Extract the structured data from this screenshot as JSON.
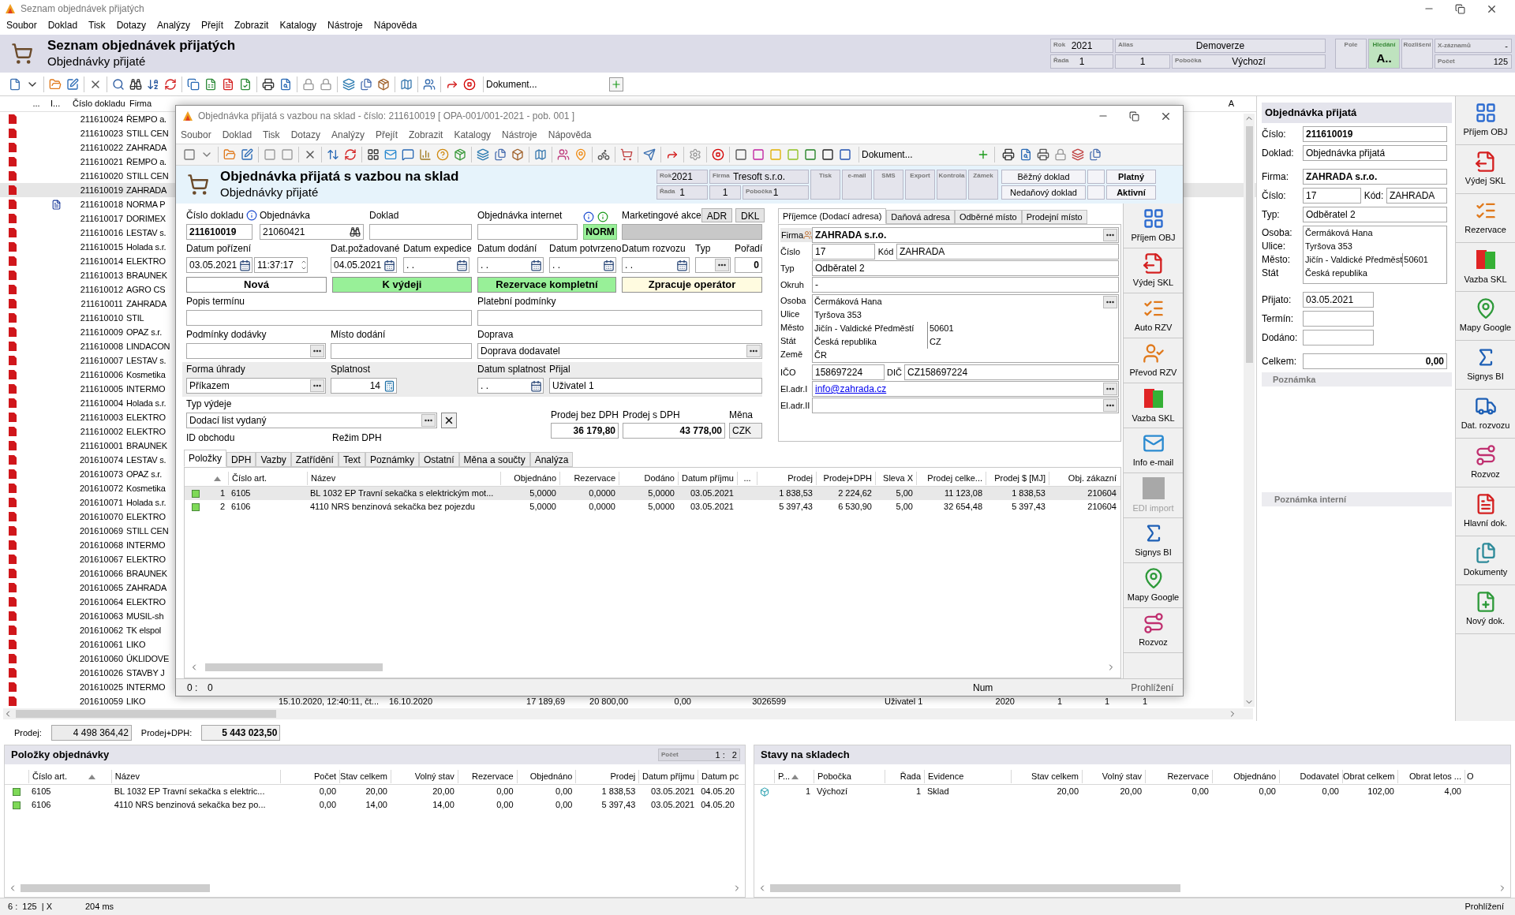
{
  "window": {
    "title": "Seznam objednávek přijatých"
  },
  "menu": [
    "Soubor",
    "Doklad",
    "Tisk",
    "Dotazy",
    "Analýzy",
    "Přejít",
    "Zobrazit",
    "Katalogy",
    "Nástroje",
    "Nápověda"
  ],
  "header": {
    "title": "Seznam objednávek přijatých",
    "subtitle": "Objednávky přijaté",
    "info": [
      {
        "label": "Rok",
        "value": "2021"
      },
      {
        "label": "Alias",
        "value": "Demoverze"
      },
      {
        "label": "Řada",
        "value": "1"
      },
      {
        "value": "1"
      },
      {
        "label": "Pobočka",
        "value": "Výchozí"
      }
    ],
    "search_info": [
      {
        "label": "Pole",
        "selected": false
      },
      {
        "label": "Hledání",
        "value": "A..",
        "selected": true
      },
      {
        "label": "Rozlišení",
        "selected": false
      },
      {
        "label": "X-záznamů",
        "value": "-",
        "selected": false
      },
      {
        "label": "Počet",
        "value": "125",
        "selected": false
      }
    ]
  },
  "toolbar": {
    "document_placeholder": "Dokument..."
  },
  "list": {
    "columns": [
      "...",
      "I...",
      "Číslo dokladu",
      "Firma"
    ],
    "column_right": "A",
    "rows": [
      {
        "number": "211610024",
        "firm": "ŘEMPO a.",
        "selected": false,
        "linked": false
      },
      {
        "number": "211610023",
        "firm": "STILL CEN",
        "selected": false,
        "linked": false
      },
      {
        "number": "211610022",
        "firm": "ZAHRADA",
        "selected": false,
        "linked": false
      },
      {
        "number": "211610021",
        "firm": "ŘEMPO a.",
        "selected": false,
        "linked": false
      },
      {
        "number": "211610020",
        "firm": "STILL CEN",
        "selected": false,
        "linked": false
      },
      {
        "number": "211610019",
        "firm": "ZAHRADA",
        "selected": true,
        "linked": false
      },
      {
        "number": "211610018",
        "firm": "NORMA P",
        "selected": false,
        "linked": true
      },
      {
        "number": "211610017",
        "firm": "DORIMEX",
        "selected": false,
        "linked": false
      },
      {
        "number": "211610016",
        "firm": "LESTAV s.",
        "selected": false,
        "linked": false
      },
      {
        "number": "211610015",
        "firm": "Holada s.r.",
        "selected": false,
        "linked": false
      },
      {
        "number": "211610014",
        "firm": "ELEKTRO",
        "selected": false,
        "linked": false
      },
      {
        "number": "211610013",
        "firm": "BRAUNEK",
        "selected": false,
        "linked": false
      },
      {
        "number": "211610012",
        "firm": "AGRO CS",
        "selected": false,
        "linked": false
      },
      {
        "number": "211610011",
        "firm": "ZAHRADA",
        "selected": false,
        "linked": false
      },
      {
        "number": "211610010",
        "firm": "STIL",
        "selected": false,
        "linked": false
      },
      {
        "number": "211610009",
        "firm": "OPAZ s.r.",
        "selected": false,
        "linked": false
      },
      {
        "number": "211610008",
        "firm": "LINDACON",
        "selected": false,
        "linked": false
      },
      {
        "number": "211610007",
        "firm": "LESTAV s.",
        "selected": false,
        "linked": false
      },
      {
        "number": "211610006",
        "firm": "Kosmetika",
        "selected": false,
        "linked": false
      },
      {
        "number": "211610005",
        "firm": "INTERMO",
        "selected": false,
        "linked": false
      },
      {
        "number": "211610004",
        "firm": "Holada s.r.",
        "selected": false,
        "linked": false
      },
      {
        "number": "211610003",
        "firm": "ELEKTRO",
        "selected": false,
        "linked": false
      },
      {
        "number": "211610002",
        "firm": "ELEKTRO",
        "selected": false,
        "linked": false
      },
      {
        "number": "211610001",
        "firm": "BRAUNEK",
        "selected": false,
        "linked": false
      },
      {
        "number": "201610074",
        "firm": "LESTAV s.",
        "selected": false,
        "linked": false
      },
      {
        "number": "201610073",
        "firm": "OPAZ s.r.",
        "selected": false,
        "linked": false
      },
      {
        "number": "201610072",
        "firm": "Kosmetika",
        "selected": false,
        "linked": false
      },
      {
        "number": "201610071",
        "firm": "Holada s.r.",
        "selected": false,
        "linked": false
      },
      {
        "number": "201610070",
        "firm": "ELEKTRO",
        "selected": false,
        "linked": false
      },
      {
        "number": "201610069",
        "firm": "STILL CEN",
        "selected": false,
        "linked": false
      },
      {
        "number": "201610068",
        "firm": "INTERMO",
        "selected": false,
        "linked": false
      },
      {
        "number": "201610067",
        "firm": "ELEKTRO",
        "selected": false,
        "linked": false
      },
      {
        "number": "201610066",
        "firm": "BRAUNEK",
        "selected": false,
        "linked": false
      },
      {
        "number": "201610065",
        "firm": "ZAHRADA",
        "selected": false,
        "linked": false
      },
      {
        "number": "201610064",
        "firm": "ELEKTRO",
        "selected": false,
        "linked": false
      },
      {
        "number": "201610063",
        "firm": "MUSIL-sh",
        "selected": false,
        "linked": false
      },
      {
        "number": "201610062",
        "firm": "TK elspol",
        "selected": false,
        "linked": false
      },
      {
        "number": "201610061",
        "firm": "LIKO",
        "selected": false,
        "linked": false
      },
      {
        "number": "201610060",
        "firm": "ÚKLIDOVE",
        "selected": false,
        "linked": false
      },
      {
        "number": "201610026",
        "firm": "STAVBY J",
        "selected": false,
        "linked": false
      },
      {
        "number": "201610025",
        "firm": "INTERMO",
        "selected": false,
        "linked": false
      },
      {
        "number": "201610059",
        "firm": "LIKO",
        "selected": false,
        "linked": false,
        "extra": [
          "15.10.2020, 12:40:11, čt...",
          "16.10.2020",
          "17 189,69",
          "20 800,00",
          "0,00",
          "3026599",
          "Uživatel 1",
          "2020",
          "1",
          "1",
          "1"
        ]
      }
    ]
  },
  "side_panel": {
    "title": "Objednávka přijatá",
    "cislo": {
      "label": "Číslo:",
      "value": "211610019"
    },
    "doklad": {
      "label": "Doklad:",
      "value": "Objednávka přijatá"
    },
    "firma": {
      "label": "Firma:",
      "value": "ZAHRADA s.r.o."
    },
    "cislo2": {
      "label": "Číslo:",
      "value": "17"
    },
    "kod": {
      "label": "Kód:",
      "value": "ZAHRADA"
    },
    "typ": {
      "label": "Typ:",
      "value": "Odběratel 2"
    },
    "address": [
      {
        "label": "Osoba:",
        "value": "Čermáková Hana"
      },
      {
        "label": "Ulice:",
        "value": "Tyršova 353"
      },
      {
        "label": "Město:",
        "value": "Jičín - Valdické Předměst",
        "value2": "50601"
      },
      {
        "label": "Stát",
        "value": "Česká republika"
      }
    ],
    "prijato": {
      "label": "Přijato:",
      "value": "03.05.2021"
    },
    "termin": {
      "label": "Termín:"
    },
    "dodano": {
      "label": "Dodáno:"
    },
    "celkem": {
      "label": "Celkem:",
      "value": "0,00"
    },
    "sections": [
      "Poznámka",
      "Poznámka interní"
    ]
  },
  "side_buttons": [
    {
      "label": "Příjem OBJ"
    },
    {
      "label": "Výdej SKL"
    },
    {
      "label": "Rezervace"
    },
    {
      "label": "Vazba SKL"
    },
    {
      "label": "Mapy Google"
    },
    {
      "label": "Signys BI"
    },
    {
      "label": "Dat. rozvozu"
    },
    {
      "label": "Rozvoz"
    },
    {
      "label": "Hlavní dok."
    },
    {
      "label": "Dokumenty"
    },
    {
      "label": "Nový dok."
    }
  ],
  "sums": {
    "prodej": {
      "label": "Prodej:",
      "value": "4 498 364,42"
    },
    "prodej_dph": {
      "label": "Prodej+DPH:",
      "value": "5 443 023,50"
    }
  },
  "items_panel": {
    "title": "Položky objednávky",
    "count_label": "Počet",
    "count": "1 :   2",
    "columns": [
      "Číslo art.",
      "Název",
      "Počet",
      "Stav celkem",
      "Volný stav",
      "Rezervace",
      "Objednáno",
      "Prodej",
      "Datum příjmu",
      "Datum pc"
    ],
    "rows": [
      {
        "color": "#7ed957",
        "cells": [
          "6105",
          "BL 1032 EP Travní sekačka s elektric...",
          "0,00",
          "20,00",
          "20,00",
          "0,00",
          "0,00",
          "1 838,53",
          "03.05.2021",
          "04.05.20"
        ]
      },
      {
        "color": "#7ed957",
        "cells": [
          "6106",
          "4110 NRS benzinová sekačka bez po...",
          "0,00",
          "14,00",
          "14,00",
          "0,00",
          "0,00",
          "5 397,43",
          "03.05.2021",
          "04.05.20"
        ]
      }
    ]
  },
  "stock_panel": {
    "title": "Stavy na skladech",
    "columns": [
      "P...",
      "Pobočka",
      "Řada",
      "Evidence",
      "Stav celkem",
      "Volný stav",
      "Rezervace",
      "Objednáno",
      "Dodavatel",
      "Obrat celkem",
      "Obrat letos ...",
      "O"
    ],
    "rows": [
      {
        "cells": [
          "1",
          "Výchozí",
          "1",
          "Sklad",
          "20,00",
          "20,00",
          "0,00",
          "0,00",
          "0,00",
          "102,00",
          "4,00"
        ]
      }
    ]
  },
  "status_bar": {
    "position": "6 :  125  | X",
    "time": "204 ms",
    "mode": "Prohlížení"
  },
  "dialog": {
    "title": "Objednávka přijatá s vazbou na sklad - číslo: 211610019  [ OPA-001/001-2021 - pob. 001 ]",
    "menu": [
      "Soubor",
      "Doklad",
      "Tisk",
      "Dotazy",
      "Analýzy",
      "Přejít",
      "Zobrazit",
      "Katalogy",
      "Nástroje",
      "Nápověda"
    ],
    "document_placeholder": "Dokument...",
    "header": {
      "title": "Objednávka přijatá s vazbou na sklad",
      "subtitle": "Objednávky přijaté",
      "info": [
        {
          "label": "Rok",
          "value": "2021"
        },
        {
          "label": "Firma",
          "value": "Tresoft s.r.o."
        },
        {
          "label": "Řada",
          "value": "1"
        },
        {
          "value": "1"
        },
        {
          "label": "Pobočka",
          "value": "1"
        }
      ],
      "flags": [
        "Tisk",
        "e-mail",
        "SMS",
        "Export",
        "Kontrola",
        "Zámek"
      ],
      "doc_types": [
        "Běžný doklad",
        "Nedaňový doklad"
      ],
      "states": [
        "Platný",
        "Aktivní"
      ]
    },
    "form": {
      "cislo_dokladu": {
        "label": "Číslo dokladu",
        "value": "211610019"
      },
      "objednavka": {
        "label": "Objednávka",
        "value": "21060421"
      },
      "doklad": {
        "label": "Doklad"
      },
      "objednavka_internet": {
        "label": "Objednávka internet",
        "badge": "NORM"
      },
      "marketingove_akce": {
        "label": "Marketingové akce",
        "buttons": [
          "ADR",
          "DKL"
        ]
      },
      "datum_porizeni": {
        "label": "Datum pořízení",
        "value": "03.05.2021",
        "time": "11:37:17"
      },
      "dat_pozadovane": {
        "label": "Dat.požadované",
        "value": "04.05.2021"
      },
      "datum_expedice": {
        "label": "Datum expedice",
        "value": ". ."
      },
      "datum_dodani": {
        "label": "Datum dodání",
        "value": ". ."
      },
      "datum_potvrzeno": {
        "label": "Datum potvrzeno",
        "value": ". ."
      },
      "datum_rozvozu": {
        "label": "Datum rozvozu",
        "value": ". ."
      },
      "typ": {
        "label": "Typ"
      },
      "poradi": {
        "label": "Pořadí",
        "value": "0"
      },
      "statuses": [
        {
          "text": "Nová",
          "color": "#ffffff"
        },
        {
          "text": "K výdeji",
          "color": "#98f098"
        },
        {
          "text": "Rezervace kompletní",
          "color": "#98f098"
        },
        {
          "text": "Zpracuje operátor",
          "color": "#fffbe0"
        }
      ],
      "popis_terminu": {
        "label": "Popis termínu"
      },
      "platebni_podminky": {
        "label": "Platební podmínky"
      },
      "podminky_dodavky": {
        "label": "Podmínky dodávky"
      },
      "misto_dodani": {
        "label": "Místo dodání"
      },
      "doprava": {
        "label": "Doprava",
        "value": "Doprava dodavatel"
      },
      "forma_uhrady": {
        "label": "Forma úhrady",
        "value": "Příkazem"
      },
      "splatnost": {
        "label": "Splatnost",
        "value": "14"
      },
      "datum_splatnost": {
        "label": "Datum splatnost",
        "value": ". ."
      },
      "prijal": {
        "label": "Přijal",
        "value": "Uživatel 1"
      },
      "typ_vydeje": {
        "label": "Typ výdeje",
        "value": "Dodací list vydaný"
      },
      "prodej_bez_dph": {
        "label": "Prodej bez DPH",
        "value": "36 179,80"
      },
      "prodej_s_dph": {
        "label": "Prodej s DPH",
        "value": "43 778,00"
      },
      "mena": {
        "label": "Měna",
        "value": "CZK"
      },
      "id_obchodu": {
        "label": "ID obchodu"
      },
      "rezim_dph": {
        "label": "Režim DPH"
      }
    },
    "address": {
      "tabs": [
        {
          "label": "Příjemce (Dodací adresa)",
          "selected": true
        },
        {
          "label": "Daňová adresa",
          "selected": false
        },
        {
          "label": "Odběrné místo",
          "selected": false
        },
        {
          "label": "Prodejní místo",
          "selected": false
        }
      ],
      "firma": {
        "label": "Firma",
        "value": "ZAHRADA s.r.o."
      },
      "cislo": {
        "label": "Číslo",
        "value": "17"
      },
      "kod": {
        "label": "Kód",
        "value": "ZAHRADA"
      },
      "typ": {
        "label": "Typ",
        "value": "Odběratel 2"
      },
      "okruh": {
        "label": "Okruh",
        "value": "-"
      },
      "lines": [
        {
          "label": "Osoba",
          "value": "Čermáková Hana"
        },
        {
          "label": "Ulice",
          "value": "Tyršova 353"
        },
        {
          "label": "Město",
          "value": "Jičín - Valdické Předměstí",
          "value2": "50601"
        },
        {
          "label": "Stát",
          "value": "Česká republika",
          "value2": "CZ"
        },
        {
          "label": "Země",
          "value": "ČR"
        }
      ],
      "ico": {
        "label": "IČO",
        "value": "158697224"
      },
      "dic": {
        "label": "DIČ",
        "value": "CZ158697224"
      },
      "email1": {
        "label": "El.adr.I",
        "value": "info@zahrada.cz"
      },
      "email2": {
        "label": "El.adr.II"
      }
    },
    "tabs": [
      {
        "label": "Položky",
        "selected": true
      },
      {
        "label": "DPH",
        "selected": false
      },
      {
        "label": "Vazby",
        "selected": false
      },
      {
        "label": "Zatřídění",
        "selected": false
      },
      {
        "label": "Text",
        "selected": false
      },
      {
        "label": "Poznámky",
        "selected": false
      },
      {
        "label": "Ostatní",
        "selected": false
      },
      {
        "label": "Měna a součty",
        "selected": false
      },
      {
        "label": "Analýza",
        "selected": false
      }
    ],
    "table": {
      "columns": [
        "Číslo art.",
        "Název",
        "Objednáno",
        "Rezervace",
        "Dodáno",
        "Datum příjmu",
        "...",
        "Prodej",
        "Prodej+DPH",
        "Sleva X",
        "Prodej celke...",
        "Prodej $ [MJ]",
        "Obj. zákazní"
      ],
      "rows": [
        {
          "number": "1",
          "selected": true,
          "color": "#7ed957",
          "cells": [
            "6105",
            "BL 1032 EP Travní sekačka s elektrickým mot...",
            "5,0000",
            "0,0000",
            "5,0000",
            "03.05.2021",
            "",
            "1 838,53",
            "2 224,62",
            "5,00",
            "11 123,08",
            "1 838,53",
            "210604"
          ]
        },
        {
          "number": "2",
          "selected": false,
          "color": "#7ed957",
          "cells": [
            "6106",
            "4110 NRS benzinová sekačka bez pojezdu",
            "5,0000",
            "0,0000",
            "5,0000",
            "03.05.2021",
            "",
            "5 397,43",
            "6 530,90",
            "5,00",
            "32 654,48",
            "5 397,43",
            "210604"
          ]
        }
      ]
    },
    "side_buttons": [
      {
        "label": "Příjem OBJ",
        "disabled": false
      },
      {
        "label": "Výdej SKL",
        "disabled": false
      },
      {
        "label": "Auto RZV",
        "disabled": false
      },
      {
        "label": "Převod RZV",
        "disabled": false
      },
      {
        "label": "Vazba SKL",
        "disabled": false
      },
      {
        "label": "Info e-mail",
        "disabled": false
      },
      {
        "label": "EDI import",
        "disabled": true
      },
      {
        "label": "Signys BI",
        "disabled": false
      },
      {
        "label": "Mapy Google",
        "disabled": false
      },
      {
        "label": "Rozvoz",
        "disabled": false
      }
    ],
    "status_bar": {
      "position": "0 :",
      "count": "0",
      "num": "Num",
      "mode": "Prohlížení"
    }
  }
}
